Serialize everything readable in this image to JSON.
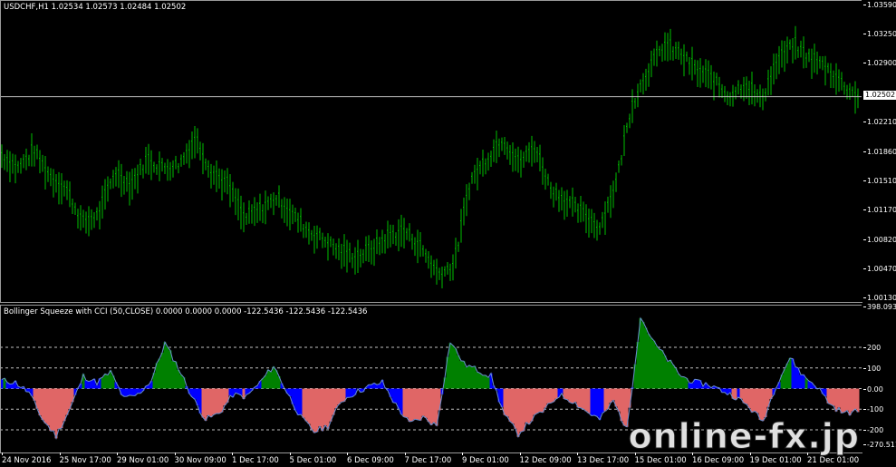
{
  "main_pane": {
    "header": "USDCHF,H1  1.02534 1.02573 1.02484 1.02502",
    "current_price_label": "1.02502",
    "price_axis": [
      "1.03590",
      "1.03250",
      "1.02900",
      "1.02210",
      "1.01860",
      "1.01510",
      "1.01170",
      "1.00820",
      "1.00470",
      "1.00130"
    ],
    "price_range": [
      1.0013,
      1.0359
    ],
    "current_price": 1.02502,
    "candle_color": "#00c000",
    "bid_line_color": "#c0c0c0"
  },
  "indicator_pane": {
    "header": "Bollinger Squeeze with CCI (50,CLOSE) 0.0000 0.0000 0.0000 -122.5436 -122.5436 -122.5436",
    "axis_labels": [
      "398.093",
      "200",
      "100",
      "0.00",
      "-100",
      "-200",
      "-270.511"
    ],
    "levels": [
      200,
      100,
      0,
      -100,
      -200
    ],
    "value_range": [
      -270.511,
      398.093
    ],
    "colors": {
      "positive": "#008000",
      "negative": "#e06666",
      "squeeze": "#0000ff",
      "line": "#6a8fd0"
    }
  },
  "time_axis": [
    "24 Nov 2016",
    "25 Nov 17:00",
    "29 Nov 01:00",
    "30 Nov 09:00",
    "1 Dec 17:00",
    "5 Dec 01:00",
    "6 Dec 09:00",
    "7 Dec 17:00",
    "9 Dec 01:00",
    "12 Dec 09:00",
    "13 Dec 17:00",
    "15 Dec 01:00",
    "16 Dec 09:00",
    "19 Dec 01:00",
    "21 Dec 01:00"
  ],
  "watermark": "online-fx.jp",
  "chart_data": [
    {
      "type": "line",
      "title": "USDCHF,H1",
      "series": [
        {
          "name": "USDCHF",
          "values": [
            1.018,
            1.0165,
            1.0185,
            1.0155,
            1.014,
            1.01,
            1.011,
            1.016,
            1.0145,
            1.0175,
            1.0165,
            1.017,
            1.02,
            1.016,
            1.0145,
            1.0105,
            1.0115,
            1.013,
            1.011,
            1.009,
            1.008,
            1.0065,
            1.006,
            1.007,
            1.0085,
            1.009,
            1.007,
            1.004,
            1.005,
            1.015,
            1.0175,
            1.02,
            1.017,
            1.019,
            1.014,
            1.0125,
            1.011,
            1.0095,
            1.0145,
            1.024,
            1.028,
            1.031,
            1.03,
            1.028,
            1.027,
            1.025,
            1.0265,
            1.0245,
            1.029,
            1.031,
            1.0295,
            1.0285,
            1.0265,
            1.025
          ]
        }
      ],
      "ylim": [
        1.0013,
        1.0359
      ]
    },
    {
      "type": "area",
      "title": "Bollinger Squeeze with CCI (50,CLOSE)",
      "series": [
        {
          "name": "CCI",
          "values": [
            40,
            30,
            -20,
            -150,
            -230,
            -100,
            60,
            30,
            80,
            -50,
            -30,
            40,
            220,
            100,
            -40,
            -150,
            -120,
            -30,
            -40,
            30,
            110,
            -20,
            -140,
            -210,
            -180,
            -60,
            -20,
            10,
            30,
            -80,
            -170,
            -140,
            -180,
            230,
            120,
            90,
            60,
            -130,
            -220,
            -150,
            -100,
            -30,
            -60,
            -110,
            -150,
            -60,
            -200,
            350,
            220,
            140,
            60,
            30,
            20,
            -10,
            -40,
            -90,
            -160,
            20,
            150,
            60,
            10,
            -80,
            -120,
            -110
          ]
        }
      ],
      "ylim": [
        -270.511,
        398.093
      ]
    }
  ]
}
